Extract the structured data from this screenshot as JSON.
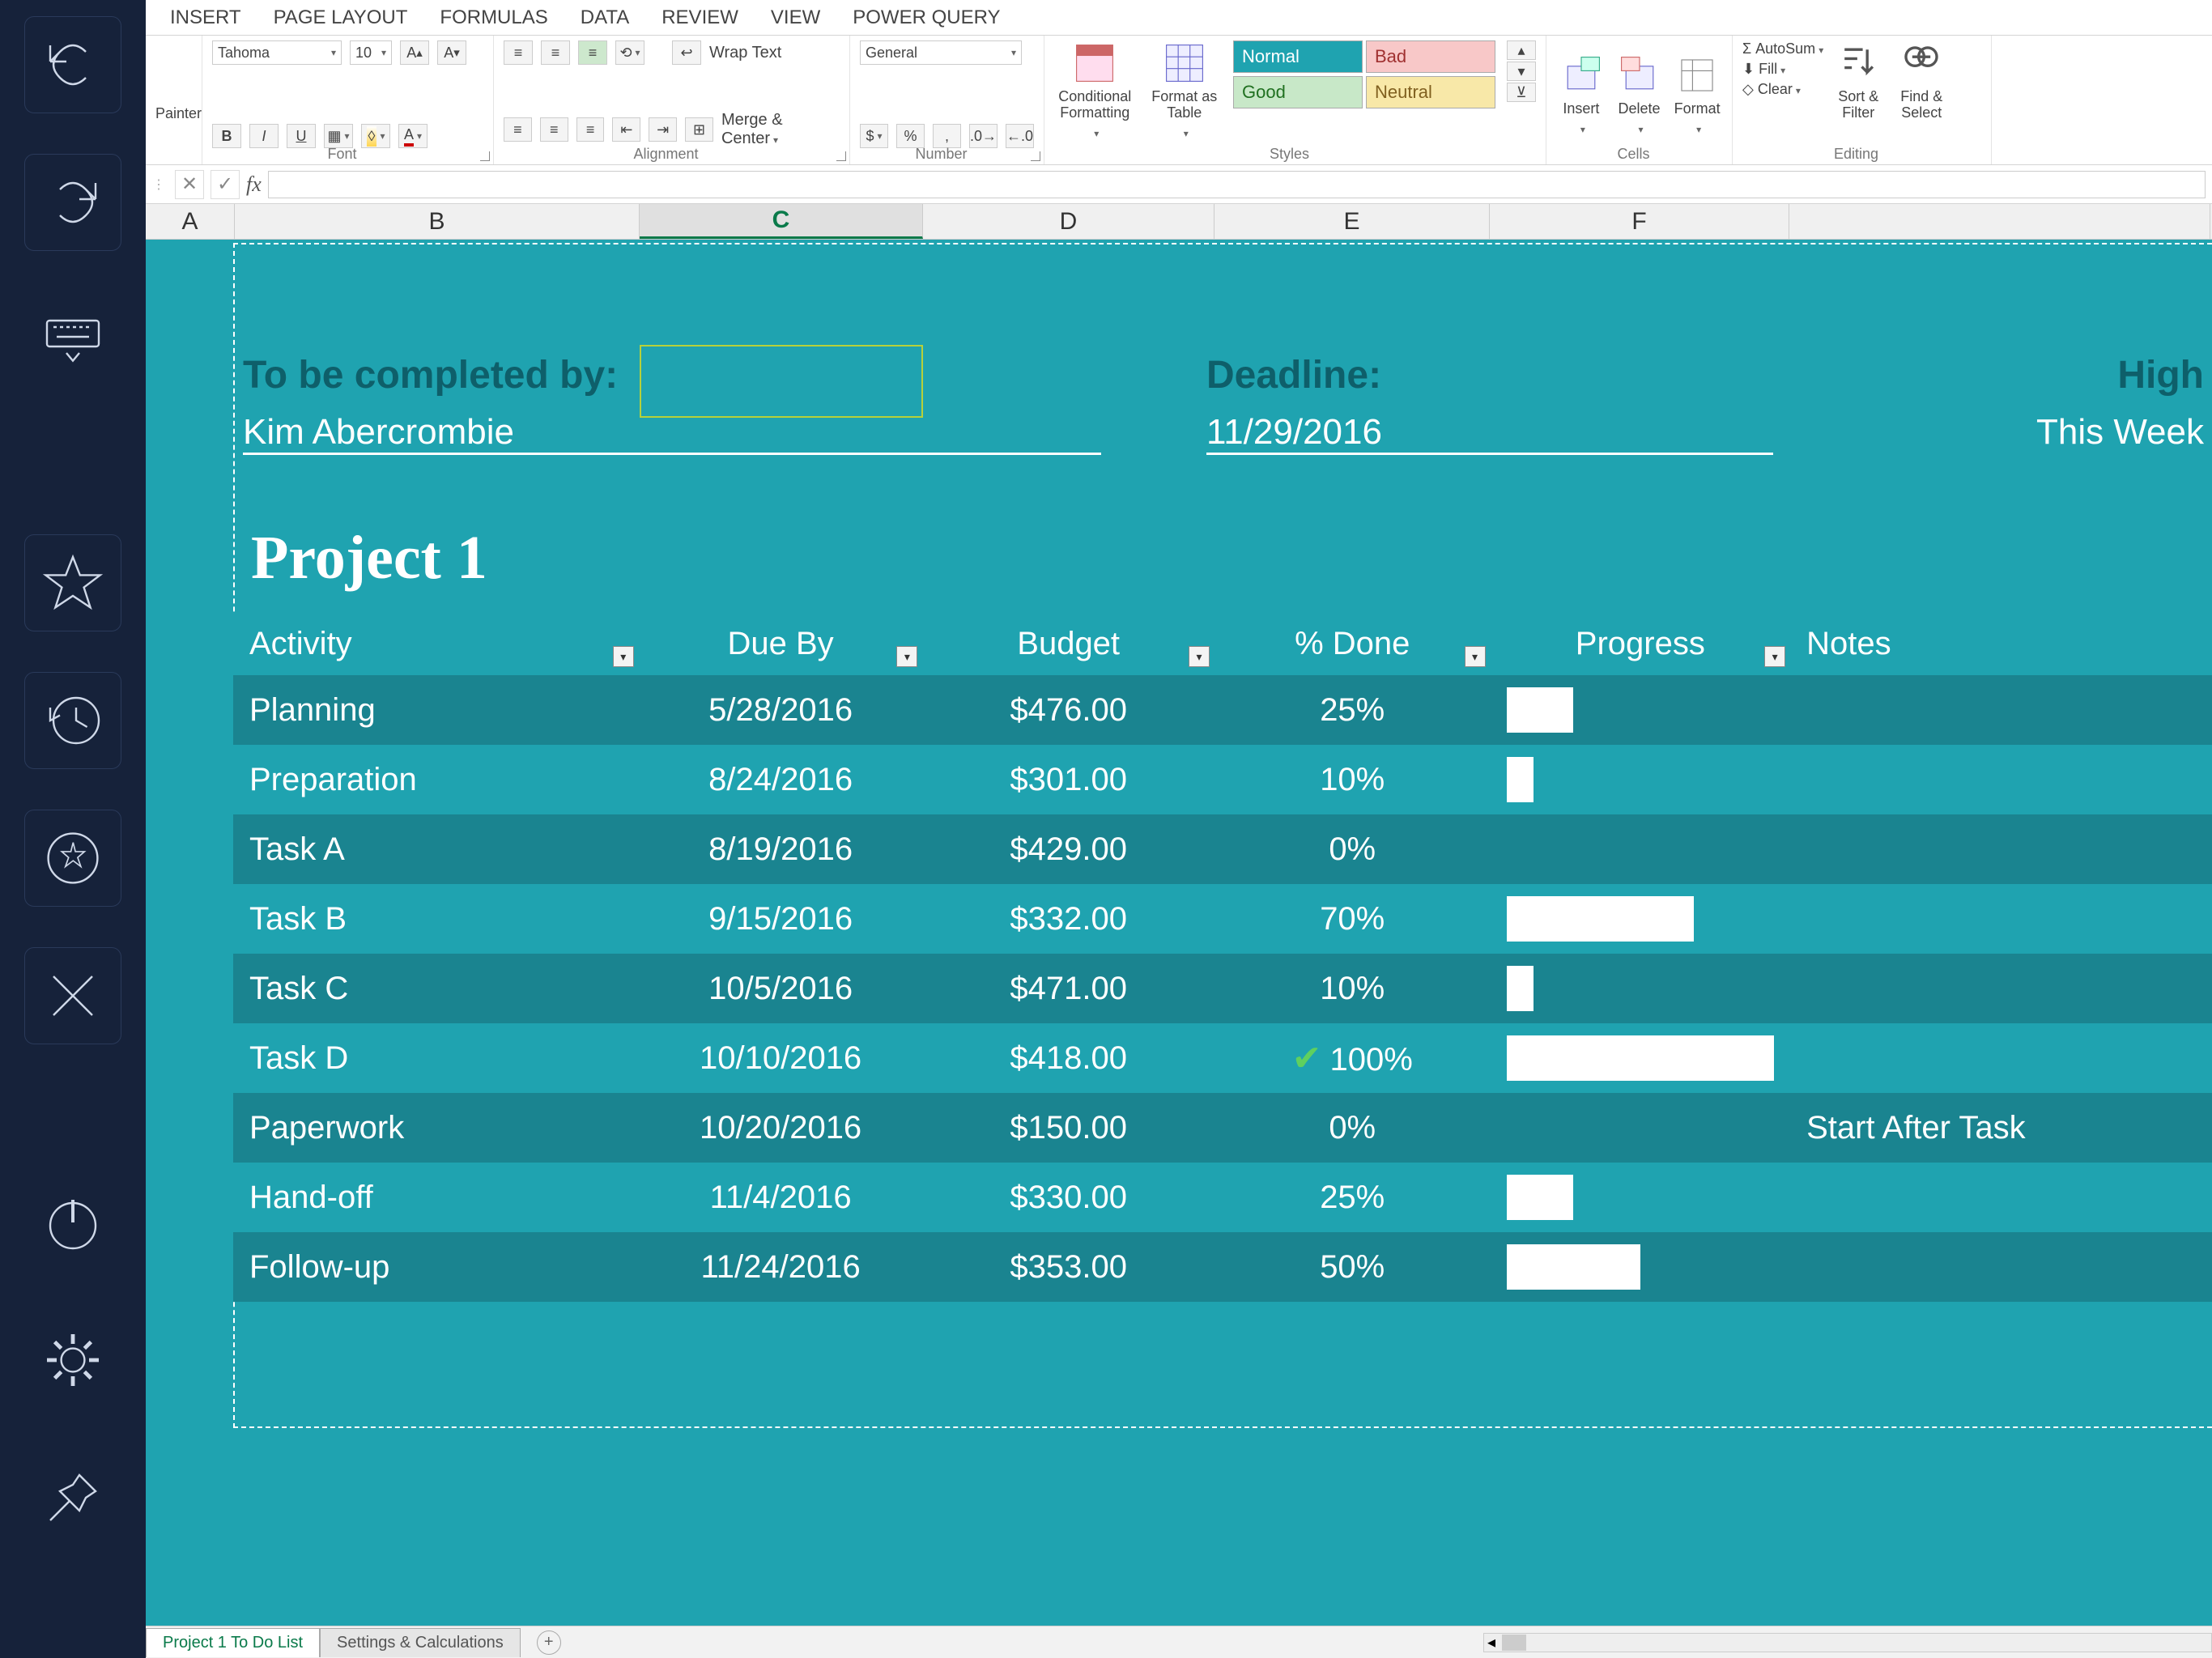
{
  "rail": {
    "items": [
      "undo",
      "redo",
      "keyboard",
      "star",
      "history",
      "apps",
      "close",
      "power",
      "settings",
      "pin"
    ]
  },
  "ribbon": {
    "tabs": [
      "INSERT",
      "PAGE LAYOUT",
      "FORMULAS",
      "DATA",
      "REVIEW",
      "VIEW",
      "POWER QUERY"
    ],
    "clipboard": {
      "painter": "Painter"
    },
    "font": {
      "name": "Tahoma",
      "size": "10",
      "group": "Font"
    },
    "alignment": {
      "wrap": "Wrap Text",
      "merge": "Merge & Center",
      "group": "Alignment"
    },
    "number": {
      "fmt": "General",
      "group": "Number"
    },
    "styles": {
      "cond": "Conditional\nFormatting",
      "table": "Format as\nTable",
      "normal": "Normal",
      "bad": "Bad",
      "good": "Good",
      "neutral": "Neutral",
      "group": "Styles"
    },
    "cells": {
      "insert": "Insert",
      "delete": "Delete",
      "format": "Format",
      "group": "Cells"
    },
    "editing": {
      "autosum": "AutoSum",
      "fill": "Fill",
      "clear": "Clear",
      "sort": "Sort &\nFilter",
      "find": "Find &\nSelect",
      "group": "Editing"
    }
  },
  "formula": {
    "fx": "fx",
    "value": ""
  },
  "cols": {
    "A": "A",
    "B": "B",
    "C": "C",
    "D": "D",
    "E": "E",
    "F": "F",
    "G": ""
  },
  "meta": {
    "lbl_completed": "To be completed by:",
    "completed_by": "Kim Abercrombie",
    "lbl_deadline": "Deadline:",
    "deadline": "11/29/2016",
    "lbl_high": "High",
    "high_val": "This Week"
  },
  "project": {
    "title": "Project 1"
  },
  "headers": {
    "activity": "Activity",
    "due": "Due By",
    "budget": "Budget",
    "pct": "% Done",
    "progress": "Progress",
    "notes": "Notes"
  },
  "rows": [
    {
      "activity": "Planning",
      "due": "5/28/2016",
      "budget": "$476.00",
      "pct": "25%",
      "progress": 25,
      "done": false,
      "notes": ""
    },
    {
      "activity": "Preparation",
      "due": "8/24/2016",
      "budget": "$301.00",
      "pct": "10%",
      "progress": 10,
      "done": false,
      "notes": ""
    },
    {
      "activity": "Task A",
      "due": "8/19/2016",
      "budget": "$429.00",
      "pct": "0%",
      "progress": 0,
      "done": false,
      "notes": ""
    },
    {
      "activity": "Task B",
      "due": "9/15/2016",
      "budget": "$332.00",
      "pct": "70%",
      "progress": 70,
      "done": false,
      "notes": ""
    },
    {
      "activity": "Task C",
      "due": "10/5/2016",
      "budget": "$471.00",
      "pct": "10%",
      "progress": 10,
      "done": false,
      "notes": ""
    },
    {
      "activity": "Task D",
      "due": "10/10/2016",
      "budget": "$418.00",
      "pct": "100%",
      "progress": 100,
      "done": true,
      "notes": ""
    },
    {
      "activity": "Paperwork",
      "due": "10/20/2016",
      "budget": "$150.00",
      "pct": "0%",
      "progress": 0,
      "done": false,
      "notes": "Start After Task"
    },
    {
      "activity": "Hand-off",
      "due": "11/4/2016",
      "budget": "$330.00",
      "pct": "25%",
      "progress": 25,
      "done": false,
      "notes": ""
    },
    {
      "activity": "Follow-up",
      "due": "11/24/2016",
      "budget": "$353.00",
      "pct": "50%",
      "progress": 50,
      "done": false,
      "notes": ""
    }
  ],
  "tabs": {
    "t1": "Project 1 To Do List",
    "t2": "Settings & Calculations"
  },
  "chart_data": {
    "type": "table",
    "title": "Project 1",
    "columns": [
      "Activity",
      "Due By",
      "Budget",
      "% Done",
      "Progress",
      "Notes"
    ],
    "data": [
      [
        "Planning",
        "5/28/2016",
        476.0,
        25,
        25,
        ""
      ],
      [
        "Preparation",
        "8/24/2016",
        301.0,
        10,
        10,
        ""
      ],
      [
        "Task A",
        "8/19/2016",
        429.0,
        0,
        0,
        ""
      ],
      [
        "Task B",
        "9/15/2016",
        332.0,
        70,
        70,
        ""
      ],
      [
        "Task C",
        "10/5/2016",
        471.0,
        10,
        10,
        ""
      ],
      [
        "Task D",
        "10/10/2016",
        418.0,
        100,
        100,
        ""
      ],
      [
        "Paperwork",
        "10/20/2016",
        150.0,
        0,
        0,
        "Start After Task"
      ],
      [
        "Hand-off",
        "11/4/2016",
        330.0,
        25,
        25,
        ""
      ],
      [
        "Follow-up",
        "11/24/2016",
        353.0,
        50,
        50,
        ""
      ]
    ]
  }
}
